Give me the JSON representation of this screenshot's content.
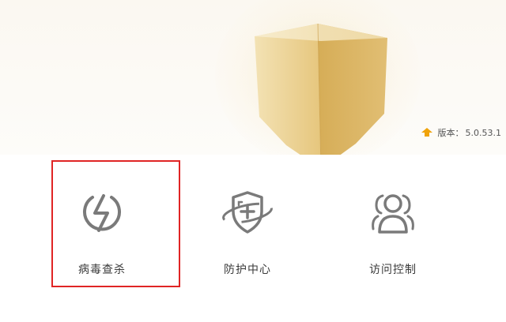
{
  "header": {
    "version_label": "版本：",
    "version_number": "5.0.53.1",
    "version_icon": "upgrade-arrow-icon",
    "shield_color": "#d9b25f"
  },
  "features": [
    {
      "label": "病毒查杀",
      "icon": "lightning-icon",
      "selected": true
    },
    {
      "label": "防护中心",
      "icon": "shield-plus-icon",
      "selected": false
    },
    {
      "label": "访问控制",
      "icon": "users-icon",
      "selected": false
    }
  ],
  "colors": {
    "selection_border": "#e02424",
    "icon_stroke": "#7a7a7a",
    "text": "#3a3a3a",
    "version_icon": "#f0a30a"
  }
}
